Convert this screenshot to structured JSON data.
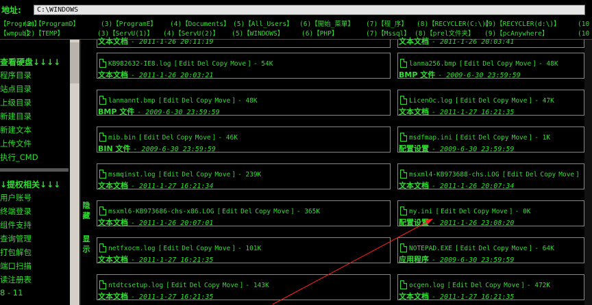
{
  "address": {
    "label": "地址:",
    "value": "C:\\WINDOWS"
  },
  "quick_links": [
    [
      {
        "n": "",
        "label": "【Program】"
      },
      {
        "n": "(2)",
        "label": "【ProgramD】"
      },
      {
        "n": "(3)",
        "label": "【ProgramE】"
      },
      {
        "n": "(4)",
        "label": "【Documents】"
      },
      {
        "n": "(5)",
        "label": "【All_Users】"
      },
      {
        "n": "(6)",
        "label": "【開始_菜單】"
      },
      {
        "n": "(7)",
        "label": "【程_序】"
      },
      {
        "n": "(8)",
        "label": "【RECYCLER(C:\\)】"
      },
      {
        "n": "(9)",
        "label": "【RECYCLER(d:\\)】"
      },
      {
        "n": "(10",
        "label": ""
      }
    ],
    [
      {
        "n": "",
        "label": "【wmpub】"
      },
      {
        "n": "(2)",
        "label": "【TEMP】"
      },
      {
        "n": "(3)",
        "label": "【ServU(1)】"
      },
      {
        "n": "(4)",
        "label": "【ServU(2)】"
      },
      {
        "n": "(5)",
        "label": "【WINDOWS】"
      },
      {
        "n": "(6)",
        "label": "【PHP】"
      },
      {
        "n": "(7)",
        "label": "【Mssql】"
      },
      {
        "n": "(8)",
        "label": "【prel文件夹】"
      },
      {
        "n": "(9)",
        "label": "【pcAnywhere】"
      },
      {
        "n": "(10",
        "label": ""
      }
    ]
  ],
  "sidebar": {
    "section1": {
      "title": "查看硬盘↓↓↓↓",
      "items": [
        "程序目录",
        "站点目录",
        "上级目录",
        "新建目录",
        "新建文本",
        "上传文件",
        "执行_CMD"
      ]
    },
    "section2": {
      "title": "↓提权相关↓↓↓",
      "items": [
        "用户账号",
        "终端登录",
        "组件支持",
        "查询管理",
        "打包解包",
        "端口扫描",
        "读注册表",
        "8 - 11"
      ]
    },
    "hide_tab": {
      "top": "隐藏",
      "bottom": "显示"
    }
  },
  "actions": {
    "open": "[",
    "edit": "Edit",
    "del": "Del",
    "copy": "Copy",
    "move": "Move",
    "close": "]"
  },
  "files_left": [
    {
      "name": "",
      "size": "",
      "type": "文本文档",
      "date": "- 2011-1-26 20:11:19",
      "partial": true
    },
    {
      "name": "KB982632-IE8.log",
      "size": "- 54K",
      "type": "文本文档",
      "date": "- 2011-1-26 20:03:21"
    },
    {
      "name": "lanmannt.bmp",
      "size": "- 48K",
      "type": "BMP 文件",
      "date": "- 2009-6-30 23:59:59"
    },
    {
      "name": "mib.bin",
      "size": "- 46K",
      "type": "BIN 文件",
      "date": "- 2009-6-30 23:59:59"
    },
    {
      "name": "msmqinst.log",
      "size": "- 239K",
      "type": "文本文档",
      "date": "- 2011-1-27 16:21:34"
    },
    {
      "name": "msxml6-KB973686-chs-x86.LOG",
      "size": "- 365K",
      "type": "文本文档",
      "date": "- 2011-1-26 20:07:01"
    },
    {
      "name": "netfxocm.log",
      "size": "- 101K",
      "type": "文本文档",
      "date": "- 2011-1-27 16:21:35"
    },
    {
      "name": "ntdtcsetup.log",
      "size": "- 143K",
      "type": "文本文档",
      "date": "- 2011-1-27 16:21:35"
    }
  ],
  "files_right": [
    {
      "name": "",
      "size": "",
      "type": "文本文档",
      "date": "- 2011-1-26 20:03:41",
      "partial": true
    },
    {
      "name": "lanma256.bmp",
      "size": "- 48K",
      "type": "BMP 文件",
      "date": "- 2009-6-30 23:59:59"
    },
    {
      "name": "LicenOc.log",
      "size": "- 47K",
      "type": "文本文档",
      "date": "- 2011-1-27 16:21:35"
    },
    {
      "name": "msdfmap.ini",
      "size": "- 1K",
      "type": "配置设置",
      "date": "- 2009-6-30 23:59:59"
    },
    {
      "name": "msxml4-KB973688-chs.LOG",
      "size": "",
      "type": "文本文档",
      "date": "- 2011-1-26 20:07:34"
    },
    {
      "name": "my.ini",
      "size": "- 0K",
      "type": "配置设置",
      "date": "- 2011-1-26 23:08:20"
    },
    {
      "name": "NOTEPAD.EXE",
      "size": "- 64K",
      "type": "应用程序",
      "date": "- 2009-6-30 23:59:59"
    },
    {
      "name": "ocgen.log",
      "size": "- 472K",
      "type": "文本文档",
      "date": "- 2011-1-27 16:21:35"
    }
  ],
  "colors": {
    "text": "#33dd33",
    "bg": "#000000",
    "border": "#888888",
    "arrow": "#ff2020"
  }
}
